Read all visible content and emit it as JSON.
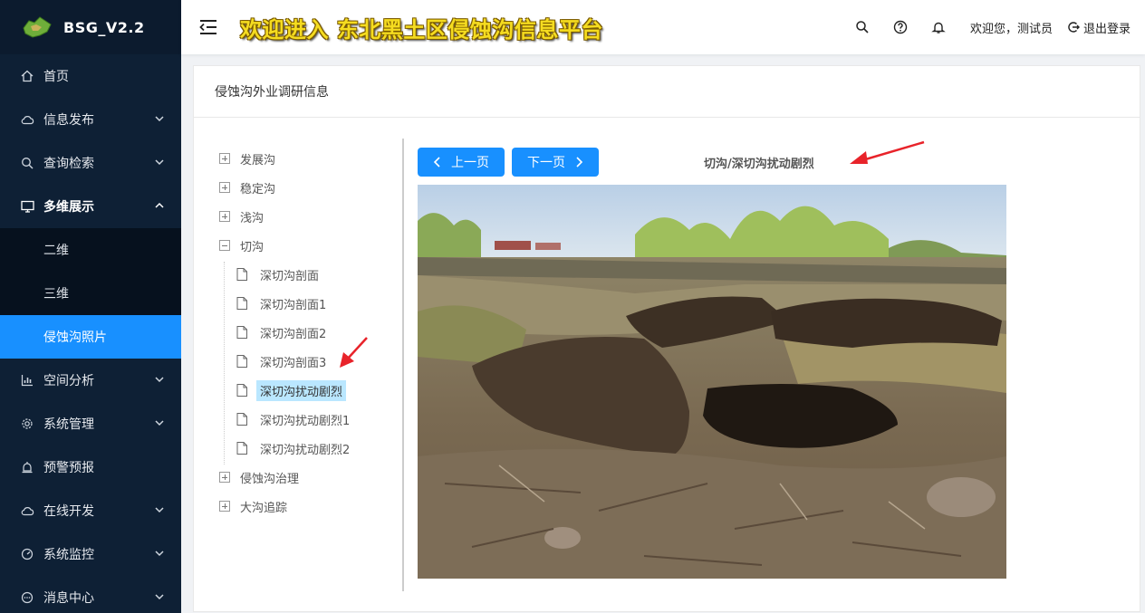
{
  "app": {
    "logo_text": "BSG_V2.2",
    "banner": "欢迎进入 东北黑土区侵蚀沟信息平台"
  },
  "sidebar": {
    "items": [
      {
        "label": "首页",
        "icon": "home-icon"
      },
      {
        "label": "信息发布",
        "icon": "cloud-icon"
      },
      {
        "label": "查询检索",
        "icon": "search-icon"
      },
      {
        "label": "多维展示",
        "icon": "monitor-icon"
      },
      {
        "label": "空间分析",
        "icon": "bar-chart-icon"
      },
      {
        "label": "系统管理",
        "icon": "gear-icon"
      },
      {
        "label": "预警预报",
        "icon": "alarm-icon"
      },
      {
        "label": "在线开发",
        "icon": "cloud-icon"
      },
      {
        "label": "系统监控",
        "icon": "dashboard-icon"
      },
      {
        "label": "消息中心",
        "icon": "message-icon"
      }
    ],
    "submenu": [
      "二维",
      "三维",
      "侵蚀沟照片"
    ]
  },
  "header": {
    "welcome": "欢迎您，测试员",
    "logout": "退出登录"
  },
  "card": {
    "title": "侵蚀沟外业调研信息"
  },
  "tree": {
    "top": [
      "发展沟",
      "稳定沟",
      "浅沟",
      "切沟"
    ],
    "leaves": [
      "深切沟剖面",
      "深切沟剖面1",
      "深切沟剖面2",
      "深切沟剖面3",
      "深切沟扰动剧烈",
      "深切沟扰动剧烈1",
      "深切沟扰动剧烈2"
    ],
    "bottom": [
      "侵蚀沟治理",
      "大沟追踪"
    ],
    "selected": "深切沟扰动剧烈"
  },
  "viewer": {
    "prev": "上一页",
    "next": "下一页",
    "photo_title": "切沟/深切沟扰动剧烈"
  },
  "colors": {
    "sidebar_bg": "#0e2035",
    "accent": "#1890ff",
    "banner_text": "#f5dc20"
  }
}
